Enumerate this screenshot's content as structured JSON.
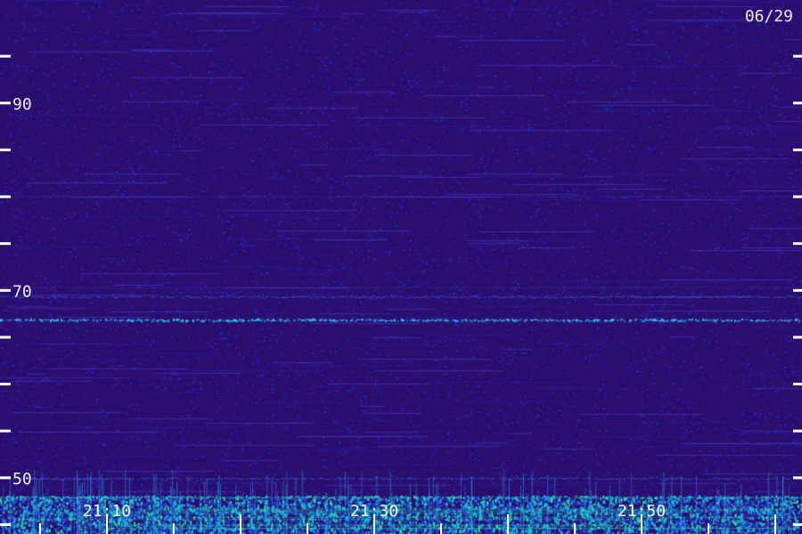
{
  "date_label": "06/29",
  "chart_data": {
    "type": "heatmap",
    "title": "",
    "xlabel": "",
    "ylabel": "",
    "ylim": [
      44,
      101
    ],
    "y_ticks": [
      45,
      50,
      55,
      60,
      65,
      70,
      75,
      80,
      85,
      90,
      95
    ],
    "y_tick_labels": [
      "",
      "50",
      "",
      "",
      "",
      "70",
      "",
      "",
      "",
      "90",
      ""
    ],
    "x_labels": [
      "21:10",
      "21:30",
      "21:50"
    ],
    "x_label_times_min": [
      10,
      30,
      50
    ],
    "x_range_min": [
      2,
      62
    ],
    "x_minor_tick_step_min": 5,
    "x_major_tick_step_min": 10,
    "colormap": [
      "#2a0f6e",
      "#3a1ca8",
      "#1f4fe0",
      "#19b8e6",
      "#29e6a8"
    ],
    "bands": [
      {
        "y": 66.8,
        "intensity": "high",
        "color": "#2fd3ff"
      },
      {
        "y": 69.3,
        "intensity": "medium",
        "color": "#3a7cff"
      },
      {
        "y": 70.3,
        "intensity": "low",
        "color": "#3a5bd6"
      },
      {
        "y": 80.0,
        "intensity": "low",
        "color": "#3a5bd6"
      },
      {
        "y": 49.9,
        "intensity": "medium",
        "color": "#2a86ff"
      },
      {
        "y": 47.9,
        "intensity": "high",
        "color": "#35e0c8"
      }
    ],
    "low_frequency_noise_below": 48
  }
}
